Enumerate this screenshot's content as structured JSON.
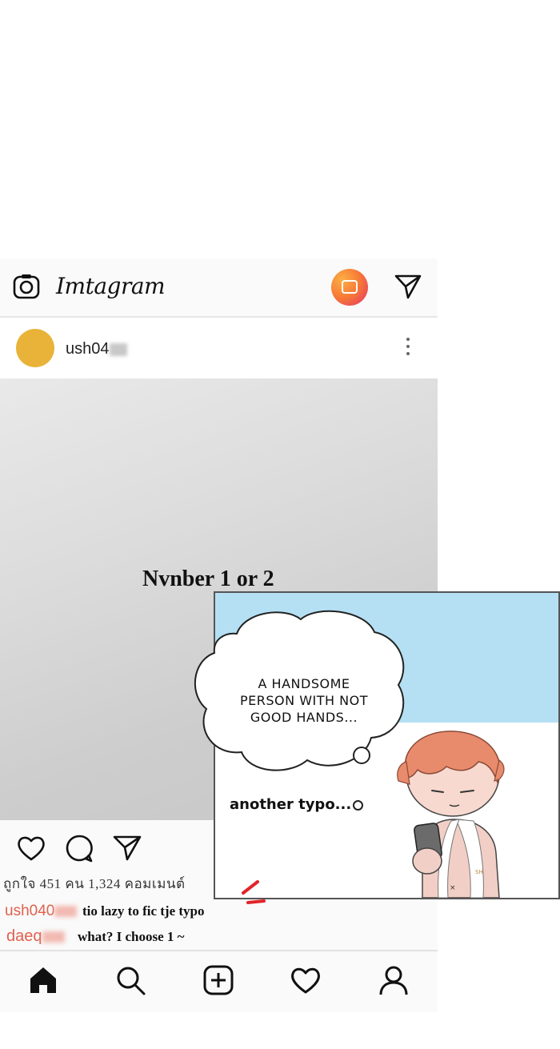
{
  "app": {
    "name": "Imtagram"
  },
  "post": {
    "username_visible": "ush04",
    "likes_line": "ถูกใจ 451 คน 1,324 คอมเมนต์"
  },
  "comments": [
    {
      "user_visible": "ush040",
      "text": "tio lazy to fic tje typo"
    },
    {
      "user_visible": "daeq",
      "text": "what? I choose 1 ~"
    }
  ],
  "caption": "Nvnber 1 or 2",
  "comic": {
    "thought": [
      "A HANDSOME",
      "PERSON WITH NOT",
      "GOOD HANDS..."
    ],
    "side_note": "another typo...",
    "mug_label": "SH"
  },
  "colors": {
    "sky": "#b5e0f4",
    "hair": "#e88b6c",
    "avatar": "#e9b339",
    "comment_user": "#e0604d",
    "red_mark": "#e0242a"
  },
  "icons": [
    "camera-icon",
    "igtv-icon",
    "send-icon",
    "more-icon",
    "heart-icon",
    "comment-icon",
    "share-icon",
    "home-icon",
    "search-icon",
    "add-post-icon",
    "activity-icon",
    "profile-icon"
  ]
}
